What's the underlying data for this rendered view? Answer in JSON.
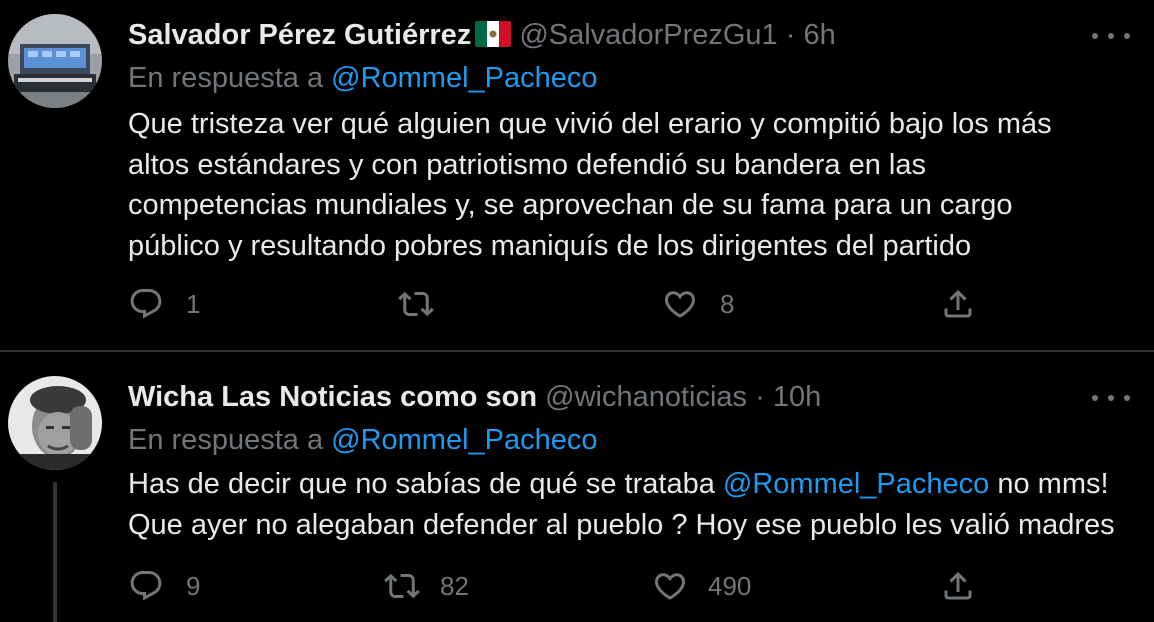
{
  "tweets": [
    {
      "name": "Salvador Pérez Gutiérrez",
      "flag_icon": "mexico-flag-icon",
      "handle": "@SalvadorPrezGu1",
      "separator": "·",
      "time": "6h",
      "reply_prefix": "En respuesta a",
      "reply_to": "@Rommel_Pacheco",
      "body_lines": [
        "Que tristeza ver qué alguien que vivió del erario y compitió bajo los más",
        "altos estándares y con patriotismo defendió su bandera en las",
        "competencias mundiales y, se aprovechan de su fama para un cargo",
        "público y resultando pobres maniquís de los dirigentes del partido"
      ],
      "replies": "1",
      "retweets": "",
      "likes": "8"
    },
    {
      "name": "Wicha Las Noticias como son",
      "handle": "@wichanoticias",
      "separator": "·",
      "time": "10h",
      "reply_prefix": "En respuesta a",
      "reply_to": "@Rommel_Pacheco",
      "body_line1_pre": "Has de decir que no sabías de qué se trataba ",
      "body_line1_mention": "@Rommel_Pacheco",
      "body_line1_post": " no mms!",
      "body_line2": "Que ayer no alegaban defender al pueblo ? Hoy ese pueblo les valió madres",
      "replies": "9",
      "retweets": "82",
      "likes": "490"
    }
  ],
  "colors": {
    "background": "#000000",
    "text": "#e7e9ea",
    "secondary": "#71767b",
    "link": "#1d9bf0",
    "divider": "#2f3336"
  },
  "icons": [
    "reply-icon",
    "retweet-icon",
    "like-icon",
    "share-icon",
    "more-icon"
  ]
}
